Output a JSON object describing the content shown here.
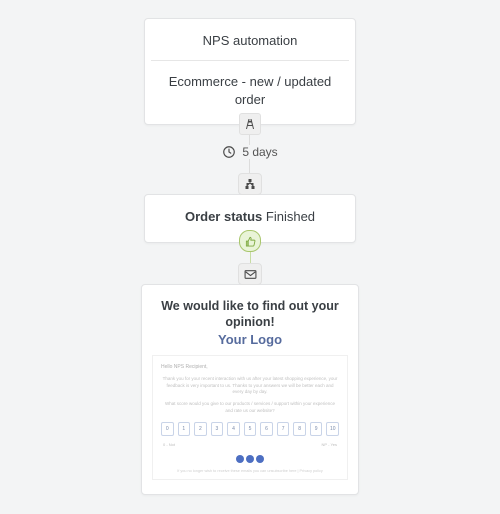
{
  "trigger": {
    "title": "NPS automation",
    "subtitle": "Ecommerce - new / updated order",
    "badge_icon": "road"
  },
  "delay": {
    "icon": "clock",
    "label": "5 days"
  },
  "condition": {
    "icon": "sitemap",
    "field_label": "Order status",
    "value": "Finished",
    "result_icon": "thumbs-up"
  },
  "email": {
    "icon": "envelope",
    "headline": "We would like to find out your opinion!",
    "logo_text": "Your Logo",
    "greeting": "Hello NPS Recipient,",
    "body_line1": "Thank you for your recent interaction with us after your latest shopping experience, your feedback is very important to us. Thanks to your answers we will be better each and every day by day.",
    "body_line2": "What score would you give to our products / services / support within your experience and rate us our website?",
    "scale_min": 0,
    "scale_max": 10,
    "scale_low_label": "0 - Not",
    "scale_high_label": "NP - Yes",
    "footer": "If you no longer wish to receive these emails you can unsubscribe here | Privacy policy"
  }
}
